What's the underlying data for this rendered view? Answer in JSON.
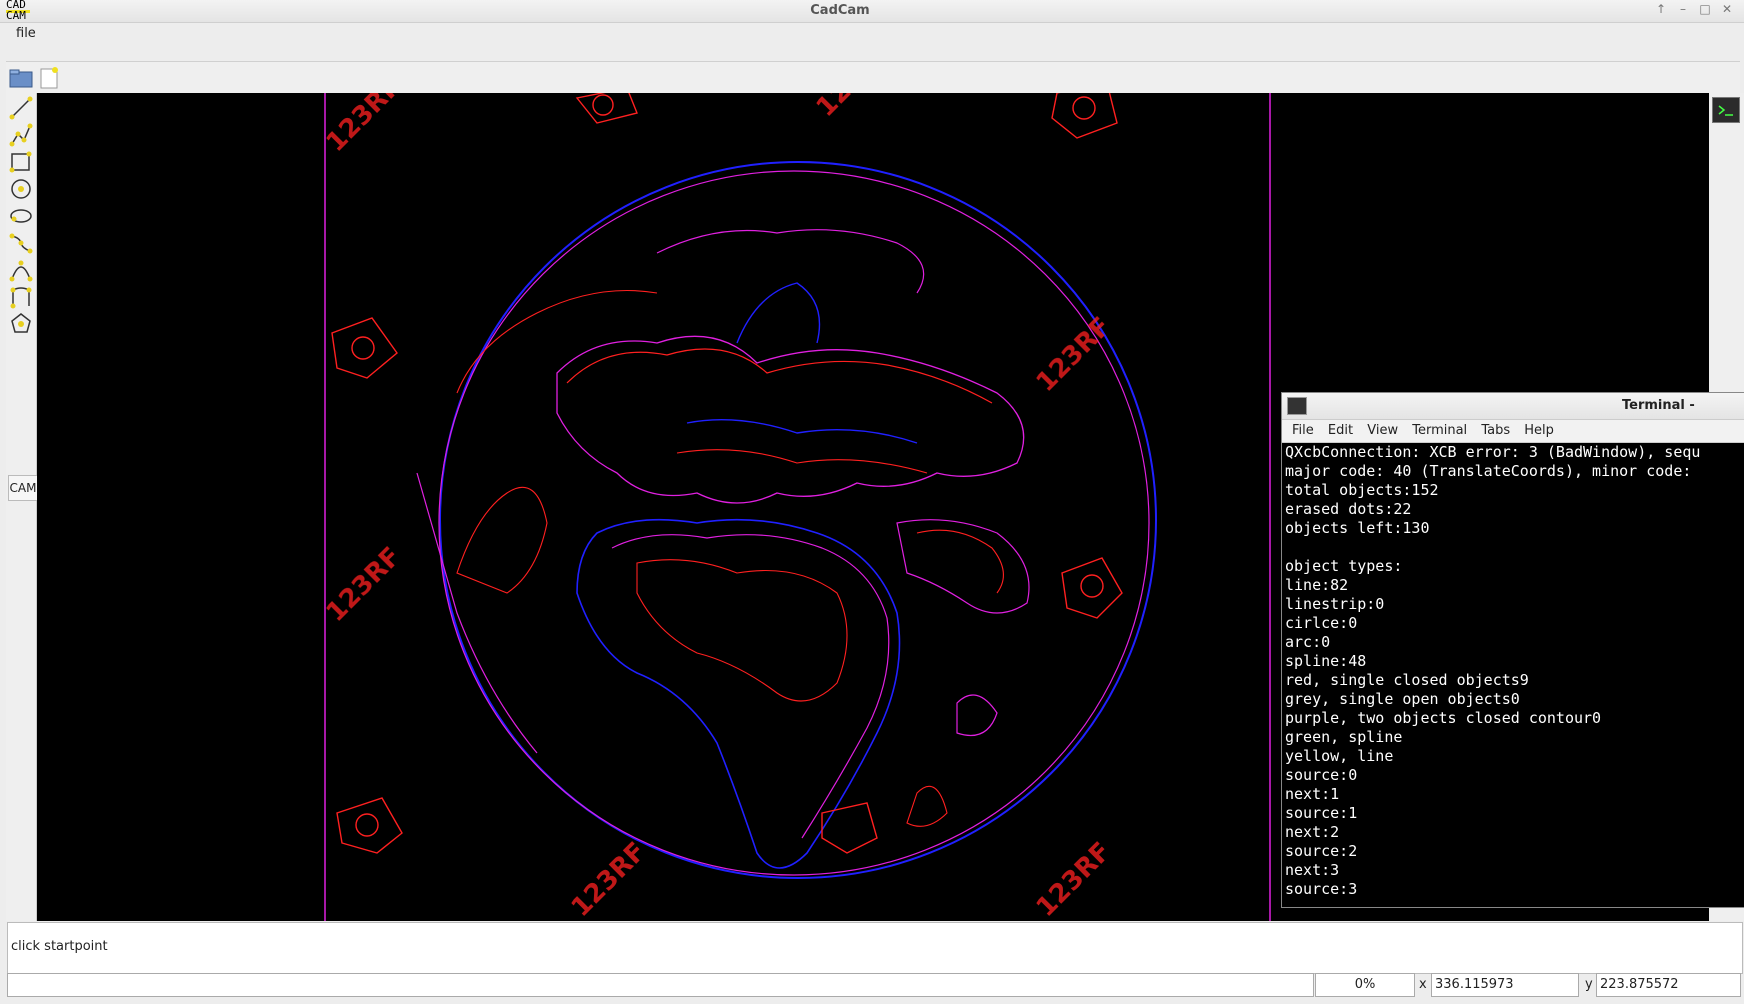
{
  "window": {
    "title": "CadCam",
    "logo_line1": "CAD",
    "logo_line2": "CAM"
  },
  "menu": {
    "file": "file"
  },
  "toolbar": {
    "open_icon": "folder-open-icon",
    "new_icon": "new-file-icon"
  },
  "left_tools": [
    "line-tool-icon",
    "polyline-tool-icon",
    "rectangle-tool-icon",
    "circle-tool-icon",
    "ellipse-tool-icon",
    "spline-tool-icon",
    "bezier-tool-icon",
    "arc-tool-icon",
    "polygon-tool-icon"
  ],
  "cam_label": "CAM",
  "watermark": "123RF",
  "command": {
    "prompt": "click startpoint"
  },
  "status": {
    "progress": "0%",
    "x_label": "x",
    "x_value": "336.115973",
    "y_label": "y",
    "y_value": "223.875572"
  },
  "terminal": {
    "title": "Terminal -",
    "menu": [
      "File",
      "Edit",
      "View",
      "Terminal",
      "Tabs",
      "Help"
    ],
    "lines": [
      "QXcbConnection: XCB error: 3 (BadWindow), sequ",
      "major code: 40 (TranslateCoords), minor code:",
      "total objects:152",
      "erased dots:22",
      "objects left:130",
      "",
      "object types:",
      "line:82",
      "linestrip:0",
      "cirlce:0",
      "arc:0",
      "spline:48",
      "red, single closed objects9",
      "grey, single open objects0",
      "purple, two objects closed contour0",
      "green, spline",
      "yellow, line",
      "source:0",
      "next:1",
      "source:1",
      "next:2",
      "source:2",
      "next:3",
      "source:3"
    ]
  },
  "colors": {
    "canvas": "#000000",
    "red": "#ff2020",
    "blue": "#2020ff",
    "magenta": "#e020e0"
  }
}
